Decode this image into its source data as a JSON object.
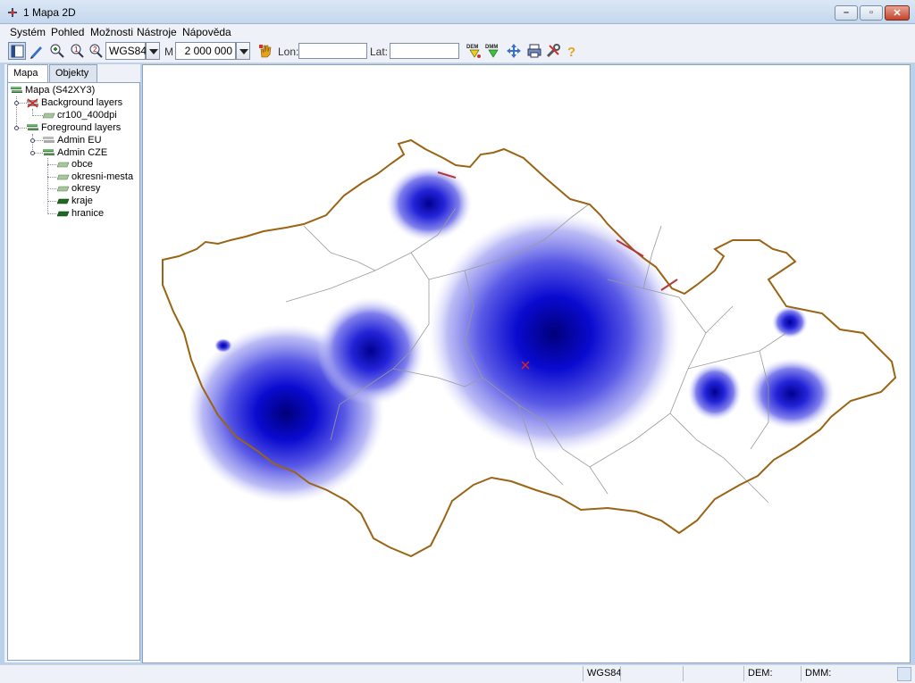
{
  "window": {
    "title": "1 Mapa 2D"
  },
  "menu": [
    "Systém",
    "Pohled",
    "Možnosti",
    "Nástroje",
    "Nápověda"
  ],
  "toolbar": {
    "projection": "WGS84",
    "scale_label": "M",
    "scale_value": "2 000 000",
    "lon_label": "Lon:",
    "lat_label": "Lat:",
    "lon_value": "",
    "lat_value": "",
    "dem_label": "DEM",
    "dmm_label": "DMM",
    "zoom1_label": "1",
    "zoom2_label": "2"
  },
  "tabs": [
    "Mapa",
    "Objekty"
  ],
  "tree": {
    "root": "Mapa (S42XY3)",
    "background": "Background layers",
    "bg_items": [
      "cr100_400dpi"
    ],
    "foreground": "Foreground layers",
    "admin_eu": "Admin EU",
    "admin_cze": "Admin CZE",
    "cze_items": [
      "obce",
      "okresni-mesta",
      "okresy",
      "kraje",
      "hranice"
    ]
  },
  "status": {
    "projection": "WGS84",
    "dem": "DEM:",
    "dmm": "DMM:"
  },
  "colors": {
    "border": "#9a6414",
    "region": "#9a9a9a",
    "coverage": "#1a1ad8"
  }
}
